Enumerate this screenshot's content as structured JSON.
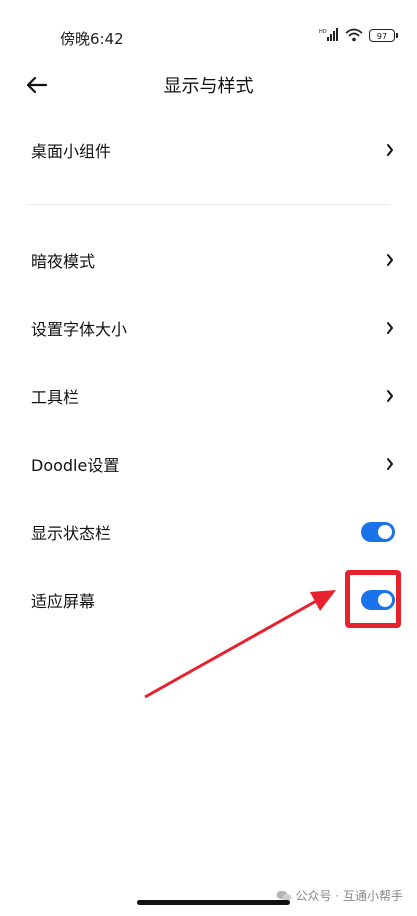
{
  "status_bar": {
    "time": "傍晚6:42",
    "network_badge": "HD",
    "battery": "97",
    "icons": [
      "signal-icon",
      "wifi-icon",
      "battery-icon"
    ]
  },
  "header": {
    "title": "显示与样式",
    "back_icon": "back-arrow-icon"
  },
  "settings": {
    "group1": [
      {
        "label": "桌面小组件",
        "control": "chevron"
      }
    ],
    "group2": [
      {
        "label": "暗夜模式",
        "control": "chevron"
      },
      {
        "label": "设置字体大小",
        "control": "chevron"
      },
      {
        "label": "工具栏",
        "control": "chevron"
      },
      {
        "label": "Doodle设置",
        "control": "chevron"
      },
      {
        "label": "显示状态栏",
        "control": "toggle",
        "on": true
      },
      {
        "label": "适应屏幕",
        "control": "toggle",
        "on": true
      }
    ]
  },
  "colors": {
    "toggle_on": "#1a73e8",
    "annotation_red": "#e8212e"
  },
  "watermark": {
    "text": "公众号 · 互通小帮手"
  }
}
